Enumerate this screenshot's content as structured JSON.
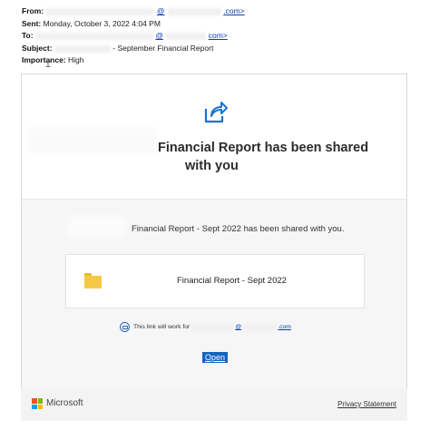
{
  "email_header": {
    "from_label": "From:",
    "from_at": "@",
    "from_domain_suffix": ".com>",
    "sent_label": "Sent:",
    "sent_value": "Monday, October 3, 2022 4:04 PM",
    "to_label": "To:",
    "to_at": "@",
    "to_domain_suffix": "com>",
    "subject_label": "Subject:",
    "subject_value": "- September Financial Report",
    "importance_label": "Importance:",
    "importance_value": "High"
  },
  "card": {
    "title_line1": "Financial Report has been shared",
    "title_line2": "with you",
    "message": "Financial Report - Sept 2022 has been shared with you.",
    "file_name": "Financial Report - Sept 2022",
    "notice_prefix": "This link will work for",
    "notice_at": "@",
    "notice_suffix": ".com",
    "open_label": "Open"
  },
  "footer": {
    "brand": "Microsoft",
    "privacy_label": "Privacy Statement"
  },
  "colors": {
    "accent": "#1565c0",
    "folder": "#f6c945",
    "ms_red": "#f25022",
    "ms_green": "#7fba00",
    "ms_blue": "#00a4ef",
    "ms_yellow": "#ffb900"
  },
  "icons": [
    "share-icon",
    "folder-icon",
    "link-info-icon",
    "microsoft-logo-icon"
  ]
}
